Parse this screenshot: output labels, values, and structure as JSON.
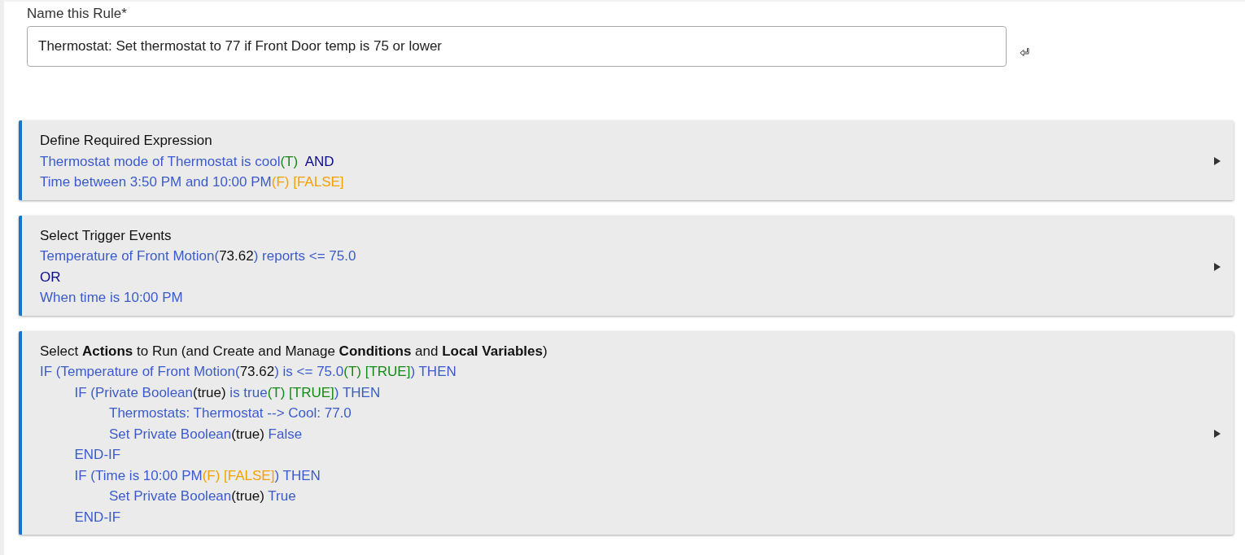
{
  "rule_name": {
    "label": "Name this Rule*",
    "value": "Thermostat: Set thermostat to 77 if Front Door temp is 75 or lower"
  },
  "sections": [
    {
      "title": "Define Required Expression",
      "lines": [
        {
          "segments": [
            {
              "kind": "text",
              "text": "Thermostat mode of Thermostat is cool"
            },
            {
              "kind": "true",
              "text": "(T)"
            },
            {
              "kind": "operator",
              "text": "  AND"
            }
          ]
        },
        {
          "segments": [
            {
              "kind": "text",
              "text": "Time between 3:50 PM and 10:00 PM"
            },
            {
              "kind": "false",
              "text": "(F) [FALSE]"
            }
          ]
        }
      ]
    },
    {
      "title": "Select Trigger Events",
      "lines": [
        {
          "segments": [
            {
              "kind": "text",
              "text": "Temperature of Front Motion("
            },
            {
              "kind": "value",
              "text": "73.62"
            },
            {
              "kind": "text",
              "text": ") reports <= 75.0"
            }
          ]
        },
        {
          "segments": [
            {
              "kind": "operator",
              "text": "OR"
            }
          ]
        },
        {
          "segments": [
            {
              "kind": "text",
              "text": "When time is 10:00 PM"
            }
          ]
        }
      ]
    },
    {
      "title": "Select **Actions** to Run (and Create and Manage **Conditions** and **Local Variables**)",
      "lines": [
        {
          "segments": [
            {
              "kind": "text",
              "text": "IF (Temperature of Front Motion("
            },
            {
              "kind": "value",
              "text": "73.62"
            },
            {
              "kind": "text",
              "text": ") is <= 75.0"
            },
            {
              "kind": "true",
              "text": "(T) [TRUE]"
            },
            {
              "kind": "text",
              "text": ") THEN"
            }
          ],
          "children": [
            {
              "segments": [
                {
                  "kind": "text",
                  "text": "IF (Private Boolean"
                },
                {
                  "kind": "value",
                  "text": "(true)"
                },
                {
                  "kind": "text",
                  "text": " is true"
                },
                {
                  "kind": "true",
                  "text": "(T) [TRUE]"
                },
                {
                  "kind": "text",
                  "text": ") THEN"
                }
              ],
              "children": [
                {
                  "segments": [
                    {
                      "kind": "text",
                      "text": "Thermostats: Thermostat --> Cool: 77.0"
                    }
                  ]
                },
                {
                  "segments": [
                    {
                      "kind": "text",
                      "text": "Set Private Boolean"
                    },
                    {
                      "kind": "value",
                      "text": "(true)"
                    },
                    {
                      "kind": "text",
                      "text": " False"
                    }
                  ]
                }
              ]
            },
            {
              "segments": [
                {
                  "kind": "text",
                  "text": "END-IF"
                }
              ]
            },
            {
              "segments": [
                {
                  "kind": "text",
                  "text": "IF (Time is 10:00 PM"
                },
                {
                  "kind": "false",
                  "text": "(F) [FALSE]"
                },
                {
                  "kind": "text",
                  "text": ") THEN"
                }
              ],
              "children": [
                {
                  "segments": [
                    {
                      "kind": "text",
                      "text": "Set Private Boolean"
                    },
                    {
                      "kind": "value",
                      "text": "(true)"
                    },
                    {
                      "kind": "text",
                      "text": " True"
                    }
                  ]
                }
              ]
            },
            {
              "segments": [
                {
                  "kind": "text",
                  "text": "END-IF"
                }
              ]
            }
          ]
        }
      ]
    }
  ]
}
